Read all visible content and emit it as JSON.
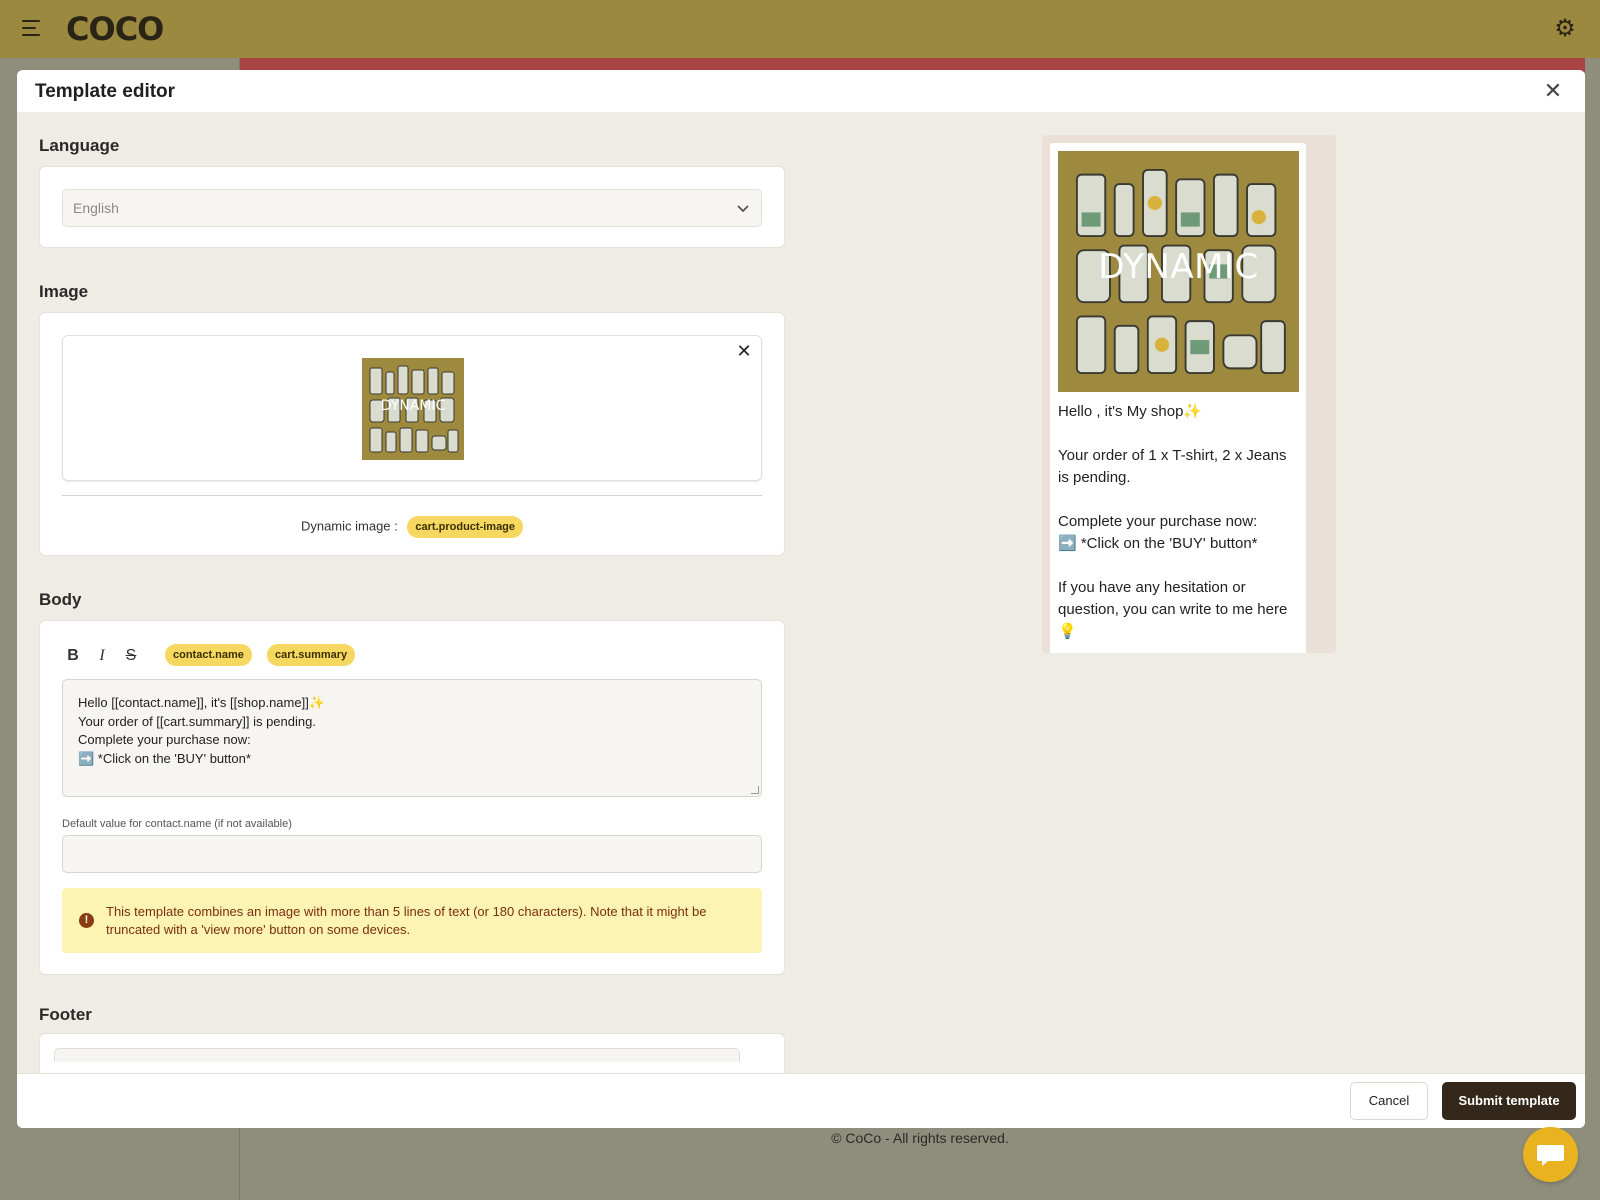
{
  "app": {
    "logo": "COCO",
    "footer": "© CoCo - All rights reserved."
  },
  "modal": {
    "title": "Template editor",
    "language": {
      "label": "Language",
      "value": "English"
    },
    "image": {
      "label": "Image",
      "thumb_text": "DYNAMIC",
      "dynamic_label": "Dynamic image :",
      "dynamic_chip": "cart.product-image"
    },
    "body": {
      "label": "Body",
      "toolbar": {
        "bold": "B",
        "italic": "I",
        "strike": "S",
        "chips": [
          "contact.name",
          "cart.summary"
        ]
      },
      "lines": [
        "Hello [[contact.name]], it's [[shop.name]]✨",
        "",
        "Your order of [[cart.summary]] is pending.",
        "",
        "Complete your purchase now:",
        "➡️ *Click on the 'BUY' button*"
      ],
      "default_label": "Default value for contact.name (if not available)",
      "default_value": "",
      "warning": "This template combines an image with more than 5 lines of text (or 180 characters). Note that it might be truncated with a 'view more' button on some devices."
    },
    "footer": {
      "label": "Footer"
    },
    "actions": {
      "cancel": "Cancel",
      "submit": "Submit template"
    }
  },
  "preview": {
    "image_text": "DYNAMIC",
    "lines": [
      "Hello  , it's My shop✨",
      "",
      "Your order of 1 x T-shirt, 2 x Jeans is pending.",
      "",
      "Complete your purchase now:",
      "➡️ *Click on the 'BUY' button*",
      "",
      "If you have any hesitation or question, you can write to me here💡"
    ]
  },
  "colors": {
    "topbar": "#9b8940",
    "accent_chip": "#f6d860",
    "submit": "#33281a",
    "warning_bg": "#fdf3b2",
    "image_bg": "#9e8a3e"
  },
  "icons": {
    "menu": "hamburger-icon",
    "settings": "gear-icon",
    "close": "close-icon",
    "select": "chevron-down-icon",
    "warning": "alert-circle-icon",
    "chat": "chat-icon"
  }
}
